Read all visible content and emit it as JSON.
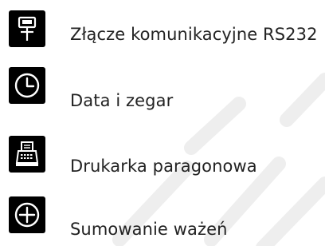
{
  "menu": {
    "items": [
      {
        "label": "Złącze komunikacyjne RS232",
        "icon": "serial-port-icon"
      },
      {
        "label": "Data i zegar",
        "icon": "clock-icon"
      },
      {
        "label": "Drukarka paragonowa",
        "icon": "receipt-printer-icon"
      },
      {
        "label": "Sumowanie ważeń",
        "icon": "plus-circle-icon"
      }
    ]
  },
  "colors": {
    "icon_background": "#000000",
    "icon_foreground": "#ffffff",
    "label_text": "#222222",
    "page_background": "#ffffff"
  }
}
